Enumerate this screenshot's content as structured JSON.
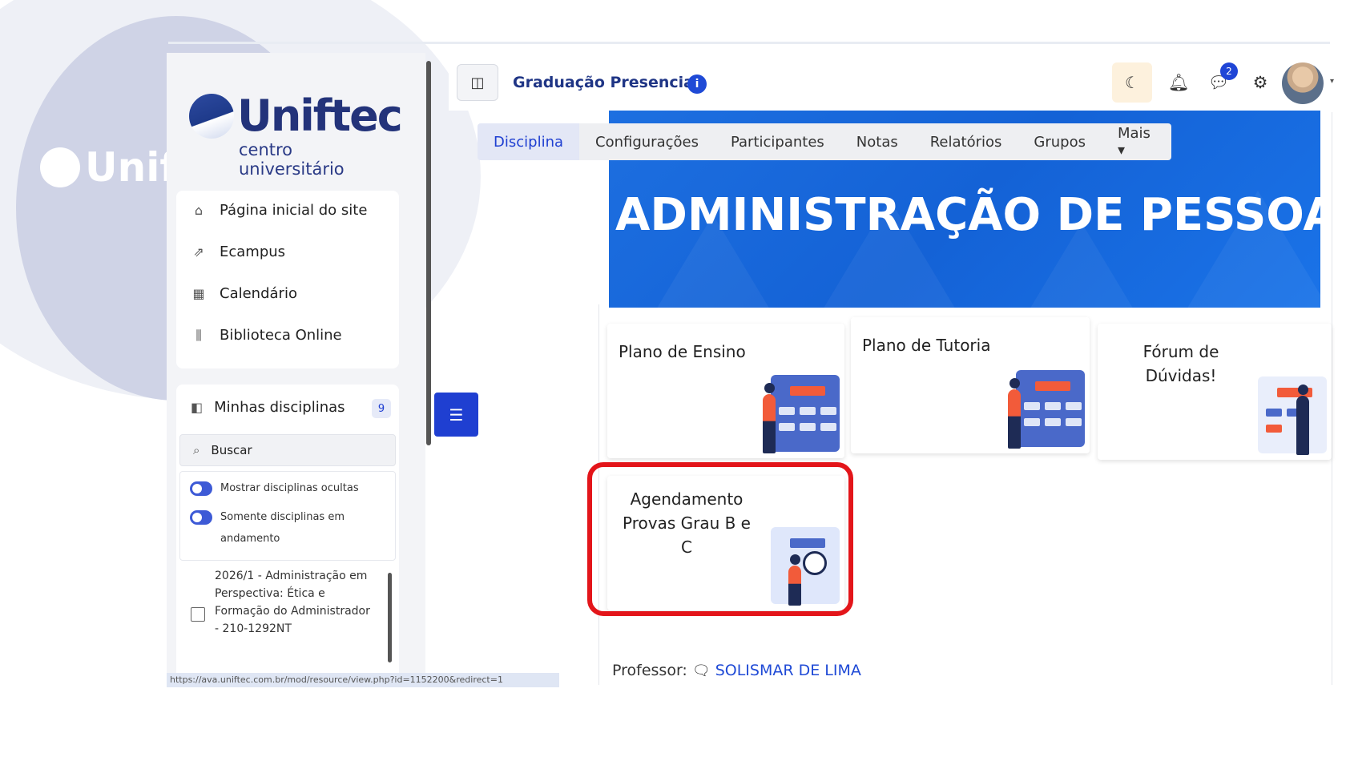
{
  "logo": {
    "name": "Uniftec",
    "subtitle": "centro universitário",
    "watermark": "Unift"
  },
  "sidebar": {
    "nav": [
      {
        "icon": "home-icon",
        "label": "Página inicial do site"
      },
      {
        "icon": "external-link-icon",
        "label": "Ecampus"
      },
      {
        "icon": "calendar-icon",
        "label": "Calendário"
      },
      {
        "icon": "library-icon",
        "label": "Biblioteca Online"
      }
    ],
    "my_courses": {
      "label": "Minhas disciplinas",
      "count": "9",
      "search_placeholder": "Buscar",
      "filters": [
        "Mostrar disciplinas ocultas",
        "Somente disciplinas em andamento"
      ],
      "courses": [
        "2026/1 - Administração em Perspectiva: Ética e Formação do Administrador - 210-1292NT"
      ]
    }
  },
  "status_url": "https://ava.uniftec.com.br/mod/resource/view.php?id=1152200&redirect=1",
  "header": {
    "title": "Graduação Presencial",
    "info_icon": "i",
    "notification_count": "2"
  },
  "tabs": [
    "Disciplina",
    "Configurações",
    "Participantes",
    "Notas",
    "Relatórios",
    "Grupos",
    "Mais ▾"
  ],
  "banner": {
    "title": "ADMINISTRAÇÃO DE PESSOAL"
  },
  "tiles": [
    {
      "label": "Plano de Ensino"
    },
    {
      "label": "Plano de Tutoria"
    },
    {
      "label": "Fórum de Dúvidas!"
    },
    {
      "label": "Agendamento Provas Grau B e C"
    }
  ],
  "professor": {
    "label": "Professor:",
    "name": "SOLISMAR DE LIMA"
  },
  "colors": {
    "primary": "#1f3fd1",
    "banner": "#1a6ae0",
    "highlight": "#e3151a",
    "brand": "#23337a"
  }
}
